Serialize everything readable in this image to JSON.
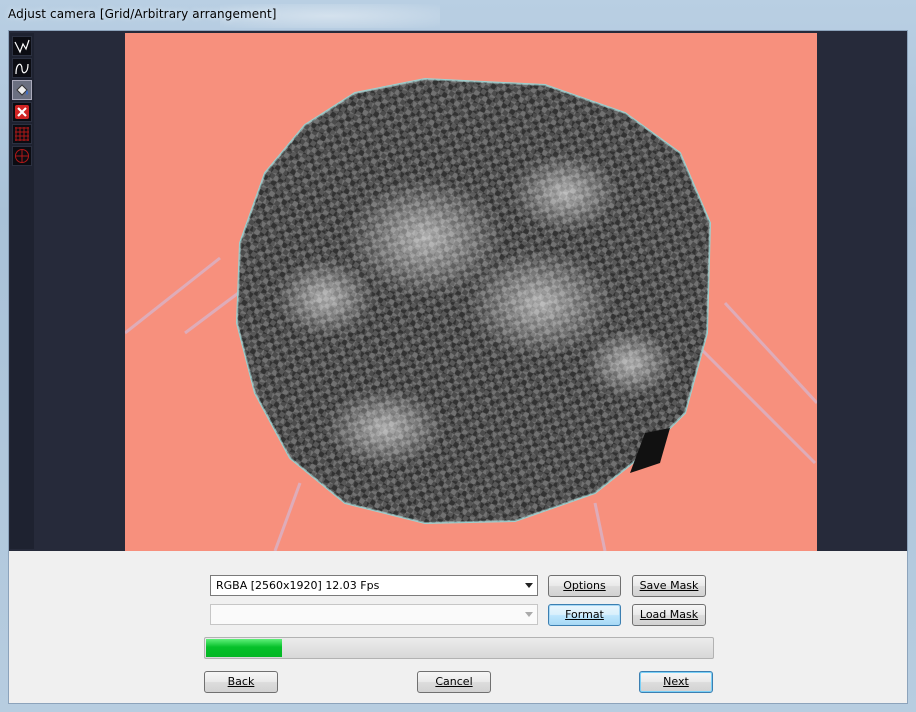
{
  "window": {
    "title": "Adjust camera  [Grid/Arbitrary arrangement]"
  },
  "toolbar": {
    "tools": [
      {
        "name": "line-tool-icon",
        "active": false
      },
      {
        "name": "curve-tool-icon",
        "active": false
      },
      {
        "name": "fill-tool-icon",
        "active": true
      },
      {
        "name": "delete-tool-icon",
        "active": false
      },
      {
        "name": "grid-tool-icon",
        "active": false
      },
      {
        "name": "crosshair-tool-icon",
        "active": false
      }
    ]
  },
  "colors": {
    "background": "#f7907d",
    "fisheye": "#4a4a4a",
    "progress": "#06c12a"
  },
  "controls": {
    "format_combo_value": "RGBA  [2560x1920]  12.03 Fps",
    "second_combo_value": "",
    "options_label": "Options",
    "save_mask_label": "Save Mask",
    "format_label": "Format",
    "load_mask_label": "Load Mask",
    "progress_fraction": 0.15,
    "back_label": "Back",
    "cancel_label": "Cancel",
    "next_label": "Next"
  }
}
